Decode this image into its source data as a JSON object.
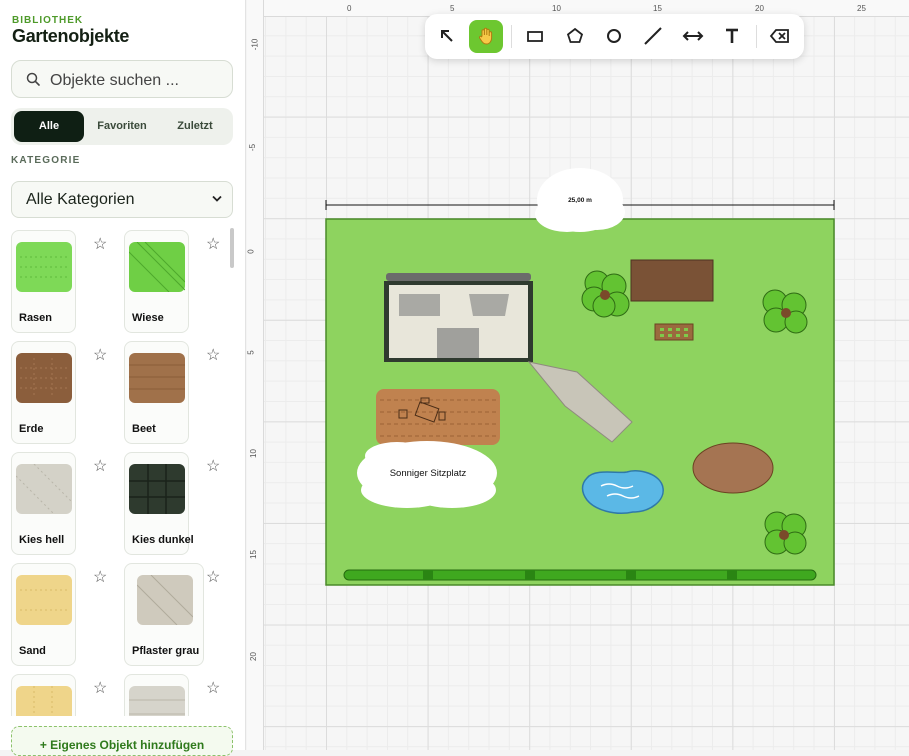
{
  "sidebar": {
    "eyebrow": "BIBLIOTHEK",
    "title": "Gartenobjekte",
    "search_placeholder": "Objekte suchen ...",
    "tabs": [
      {
        "label": "Alle",
        "active": true
      },
      {
        "label": "Favoriten",
        "active": false
      },
      {
        "label": "Zuletzt",
        "active": false
      }
    ],
    "category_label": "KATEGORIE",
    "category_selected": "Alle Kategorien",
    "items": [
      {
        "label": "Rasen",
        "color": "#7ed957"
      },
      {
        "label": "Wiese",
        "color": "#6fcf45"
      },
      {
        "label": "Erde",
        "color": "#8b5e3c"
      },
      {
        "label": "Beet",
        "color": "#a0714a"
      },
      {
        "label": "Kies hell",
        "color": "#d4d2c8"
      },
      {
        "label": "Kies dunkel",
        "color": "#2e3a2e"
      },
      {
        "label": "Sand",
        "color": "#efd58a"
      },
      {
        "label": "Pflaster grau",
        "color": "#cfcabd"
      },
      {
        "label": "",
        "color": "#efd58a"
      },
      {
        "label": "",
        "color": "#d6d4cb"
      }
    ],
    "add_button": "+ Eigenes Objekt hinzufügen"
  },
  "canvas": {
    "ruler_x": [
      "0",
      "5",
      "10",
      "15",
      "20",
      "25"
    ],
    "ruler_y": [
      "-10",
      "-5",
      "0",
      "5",
      "10",
      "15",
      "20"
    ],
    "dimension_label": "25,00 m",
    "note_label": "Sonniger Sitzplatz",
    "colors": {
      "lawn": "#8ed35f",
      "tree": "#63c332",
      "pond": "#5bb8e6",
      "earth": "#a57452",
      "terrace": "#c0824f",
      "accent": "#6dc730"
    }
  },
  "toolbar": {
    "tools": [
      {
        "name": "select-tool",
        "icon": "arrow-icon"
      },
      {
        "name": "pan-tool",
        "icon": "hand-icon",
        "active": true
      },
      {
        "name": "rectangle-tool",
        "icon": "rectangle-icon"
      },
      {
        "name": "polygon-tool",
        "icon": "pentagon-icon"
      },
      {
        "name": "circle-tool",
        "icon": "circle-icon"
      },
      {
        "name": "line-tool",
        "icon": "line-icon"
      },
      {
        "name": "measure-tool",
        "icon": "double-arrow-icon"
      },
      {
        "name": "text-tool",
        "icon": "text-icon"
      },
      {
        "name": "delete-tool",
        "icon": "backspace-icon"
      }
    ]
  }
}
